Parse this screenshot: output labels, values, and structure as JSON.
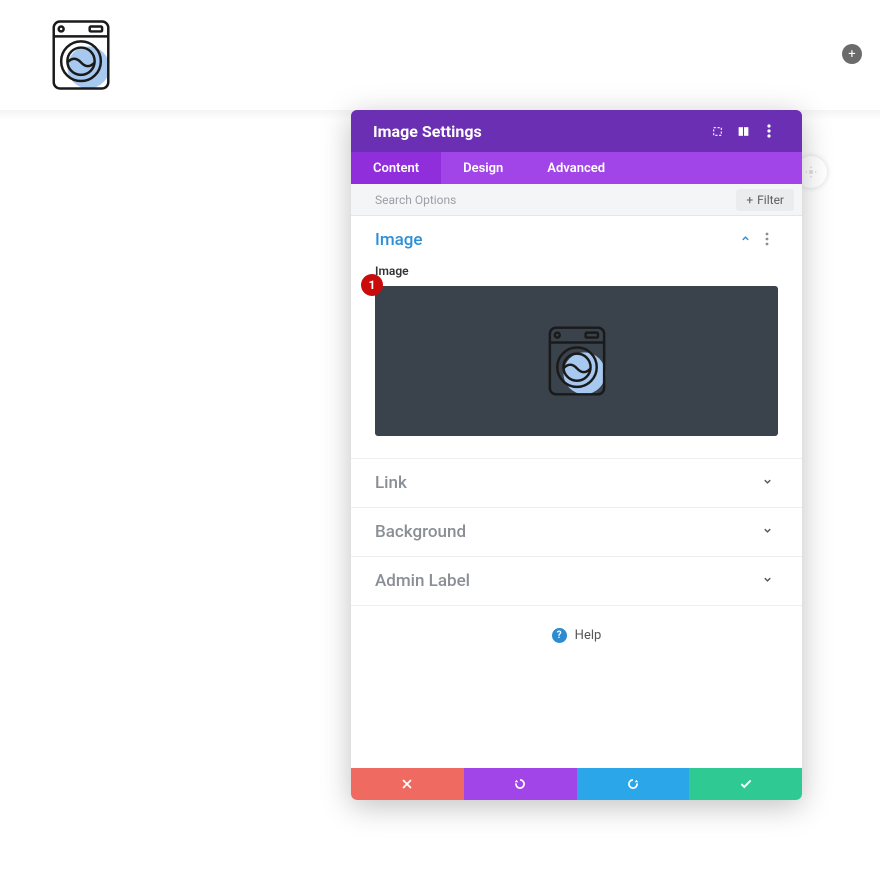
{
  "page": {
    "add_button_symbol": "+"
  },
  "panel": {
    "title": "Image Settings",
    "tabs": [
      {
        "label": "Content",
        "active": true
      },
      {
        "label": "Design",
        "active": false
      },
      {
        "label": "Advanced",
        "active": false
      }
    ],
    "search_placeholder": "Search Options",
    "filter_label": "Filter",
    "sections": {
      "image": {
        "title": "Image",
        "field_label": "Image",
        "step_badge": "1"
      },
      "link": {
        "title": "Link"
      },
      "background": {
        "title": "Background"
      },
      "admin_label": {
        "title": "Admin Label"
      }
    },
    "help_label": "Help"
  },
  "icons": {
    "expand": "expand-icon",
    "columns": "columns-icon",
    "kebab": "kebab-icon",
    "chevron_up": "chevron-up-icon",
    "chevron_down": "chevron-down-icon",
    "plus": "plus-icon",
    "close_x": "close-icon",
    "undo": "undo-icon",
    "redo": "redo-icon",
    "check": "check-icon",
    "drag": "drag-icon",
    "washer": "washing-machine-icon"
  },
  "colors": {
    "header": "#6b2fb3",
    "tabs": "#a245e8",
    "tab_active": "#912edb",
    "accent": "#2d8fd4",
    "cancel": "#ef6a61",
    "undo": "#a245e8",
    "redo": "#2aa6e9",
    "confirm": "#2fc994",
    "badge": "#c90b0b",
    "preview_bg": "#3a424c"
  }
}
